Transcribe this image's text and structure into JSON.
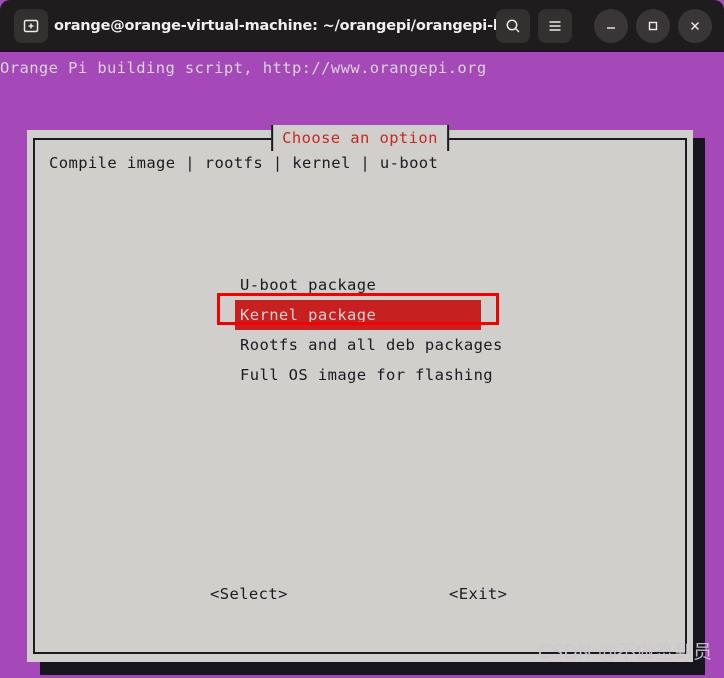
{
  "window": {
    "title": "orange@orange-virtual-machine: ~/orangepi/orangepi-build",
    "titlebar_background": "#1F1C1D",
    "buttons": {
      "new_tab": "new-tab",
      "search": "search",
      "menu": "hamburger-menu",
      "minimize": "minimize",
      "maximize": "maximize",
      "close": "close"
    }
  },
  "terminal": {
    "background": "#A649B8",
    "foreground": "#D9D3DA",
    "line1": "Orange Pi building script, http://www.orangepi.org"
  },
  "dialog": {
    "title": "Choose an option",
    "title_color": "#C62828",
    "background": "#D0CFCB",
    "border_color": "#1A1A22",
    "prompt": "Compile image | rootfs | kernel | u-boot",
    "menu": [
      {
        "label": "U-boot package",
        "selected": false
      },
      {
        "label": "Kernel package",
        "selected": true
      },
      {
        "label": "Rootfs and all deb packages",
        "selected": false
      },
      {
        "label": "Full OS image for flashing",
        "selected": false
      }
    ],
    "selection_background": "#C62020",
    "selection_foreground": "#D5D3D0",
    "buttons": {
      "select": "<Select>",
      "exit": "<Exit>"
    }
  },
  "annotation": {
    "color": "#F30000",
    "target": "Kernel package"
  },
  "watermark": {
    "text": "CSDN @不做签到员"
  }
}
